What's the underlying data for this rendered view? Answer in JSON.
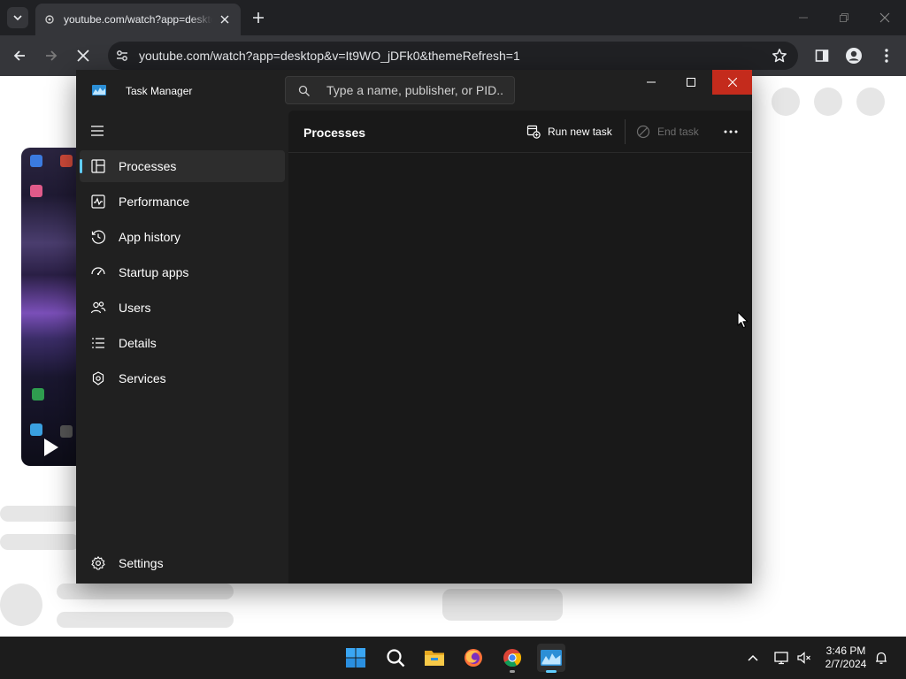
{
  "browser": {
    "tab_title": "youtube.com/watch?app=desktop&v=It9WO_jDFk0&themeRefresh=1",
    "url": "youtube.com/watch?app=desktop&v=It9WO_jDFk0&themeRefresh=1",
    "loading": true
  },
  "task_manager": {
    "title": "Task Manager",
    "search_placeholder": "Type a name, publisher, or PID...",
    "nav": {
      "items": [
        {
          "label": "Processes",
          "icon": "processes-grid-icon",
          "active": true
        },
        {
          "label": "Performance",
          "icon": "performance-chart-icon",
          "active": false
        },
        {
          "label": "App history",
          "icon": "history-clock-icon",
          "active": false
        },
        {
          "label": "Startup apps",
          "icon": "startup-speedometer-icon",
          "active": false
        },
        {
          "label": "Users",
          "icon": "users-icon",
          "active": false
        },
        {
          "label": "Details",
          "icon": "details-list-icon",
          "active": false
        },
        {
          "label": "Services",
          "icon": "services-puzzle-icon",
          "active": false
        }
      ],
      "settings_label": "Settings"
    },
    "content": {
      "title": "Processes",
      "run_new_task_label": "Run new task",
      "end_task_label": "End task"
    }
  },
  "taskbar": {
    "apps": [
      "start-icon",
      "search-icon",
      "file-explorer-icon",
      "firefox-icon",
      "chrome-icon",
      "task-manager-icon"
    ],
    "time": "3:46 PM",
    "date": "2/7/2024"
  },
  "colors": {
    "accent": "#60cdff",
    "close_red": "#c42b1c",
    "tm_background": "#202020",
    "tm_content": "#191919"
  }
}
